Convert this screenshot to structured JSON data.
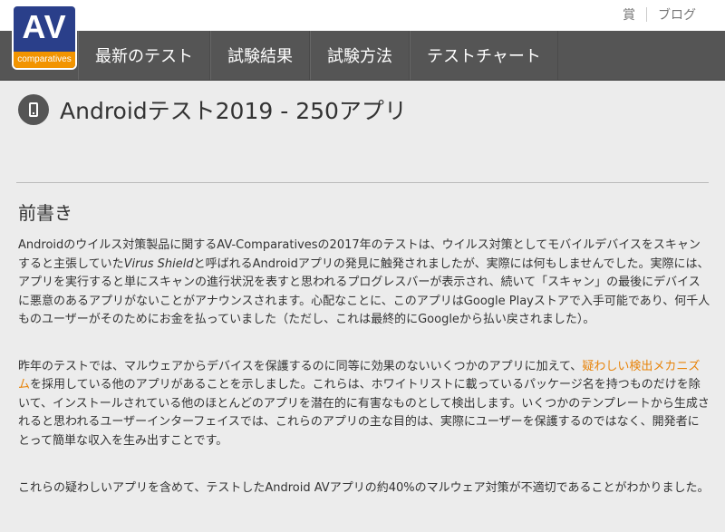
{
  "top_links": {
    "awards": "賞",
    "blog": "ブログ"
  },
  "logo": {
    "main": "AV",
    "sub": "comparatives"
  },
  "nav": {
    "items": [
      "最新のテスト",
      "試験結果",
      "試験方法",
      "テストチャート"
    ]
  },
  "page": {
    "title": "Androidテスト2019 - 250アプリ",
    "section_title": "前書き",
    "para1": {
      "a": "Androidのウイルス対策製品に関するAV-Comparativesの2017年のテストは、ウイルス対策としてモバイルデバイスをスキャンすると主張していた",
      "italic": "Virus Shield",
      "b": "と呼ばれるAndroidアプリの発見に触発されましたが、実際には何もしませんでした。実際には、アプリを実行すると単にスキャンの進行状況を表すと思われるプログレスバーが表示され、続いて「スキャン」の最後にデバイスに悪意のあるアプリがないことがアナウンスされます。心配なことに、このアプリはGoogle Playストアで入手可能であり、何千人ものユーザーがそのためにお金を払っていました（ただし、これは最終的にGoogleから払い戻されました）。"
    },
    "para2": {
      "a": "昨年のテストでは、マルウェアからデバイスを保護するのに同等に効果のないいくつかのアプリに加えて、",
      "link": "疑わしい検出メカニズム",
      "b": "を採用している他のアプリがあることを示しました。これらは、ホワイトリストに載っているパッケージ名を持つものだけを除いて、インストールされている他のほとんどのアプリを潜在的に有害なものとして検出します。いくつかのテンプレートから生成されると思われるユーザーインターフェイスでは、これらのアプリの主な目的は、実際にユーザーを保護するのではなく、開発者にとって簡単な収入を生み出すことです。"
    },
    "para3": "これらの疑わしいアプリを含めて、テストしたAndroid AVアプリの約40%のマルウェア対策が不適切であることがわかりました。"
  },
  "colors": {
    "nav_bg": "#555555",
    "logo_blue": "#2a3f8a",
    "logo_orange": "#f29400",
    "link": "#e8840a",
    "page_bg": "#ececec"
  }
}
